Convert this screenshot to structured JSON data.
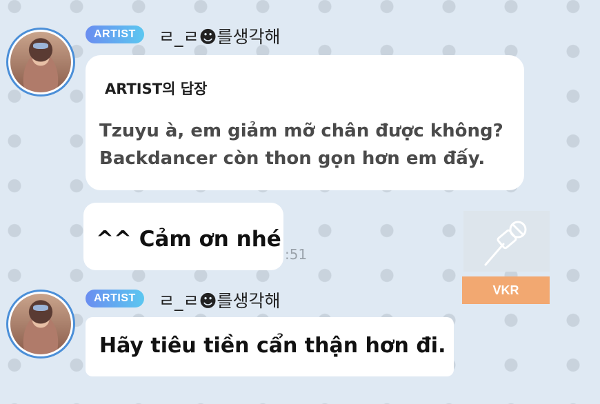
{
  "messages": [
    {
      "badge": "ARTIST",
      "username": "ㄹ_ㄹ☻를생각해",
      "reply_title": "ARTIST의 답장",
      "reply_text_line1": "Tzuyu à, em giảm mỡ chân được không?",
      "reply_text_line2": "Backdancer còn thon gọn hơn em đấy."
    },
    {
      "text": "^^ Cảm ơn nhé",
      "time": ":51"
    },
    {
      "badge": "ARTIST",
      "username": "ㄹ_ㄹ☻를생각해",
      "text": "Hãy tiêu tiền cẩn thận hơn đi."
    }
  ],
  "watermark": {
    "icon": "microphone-icon",
    "label": "VKR"
  },
  "colors": {
    "background": "#dfe9f3",
    "badge_start": "#6a8df0",
    "badge_end": "#5bc7f0",
    "avatar_ring": "#4b8fd8",
    "watermark_label": "#f2a871"
  }
}
